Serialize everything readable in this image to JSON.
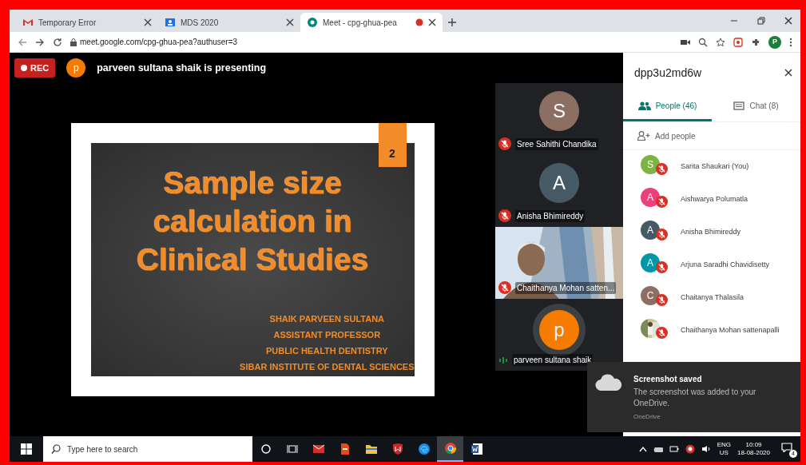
{
  "browser": {
    "tabs": [
      {
        "label": "Temporary Error",
        "selected": false,
        "recording": false
      },
      {
        "label": "MDS 2020",
        "selected": false,
        "recording": false
      },
      {
        "label": "Meet - cpg-ghua-pea",
        "selected": true,
        "recording": true
      }
    ],
    "address": "meet.google.com/cpg-ghua-pea?authuser=3",
    "profile_initial": "P"
  },
  "meet": {
    "rec_label": "REC",
    "presenter_initial": "p",
    "presenting_text": "parveen sultana shaik is presenting",
    "slide": {
      "number": "2",
      "title": [
        "Sample size",
        "calculation in",
        "Clinical Studies"
      ],
      "author_lines": [
        "SHAIK PARVEEN SULTANA",
        "ASSISTANT PROFESSOR",
        "PUBLIC HEALTH DENTISTRY",
        "SIBAR INSTITUTE OF DENTAL SCIENCES"
      ]
    },
    "tiles": [
      {
        "kind": "avatar",
        "initial": "S",
        "color": "#8d6e63",
        "name": "Sree Sahithi Chandika",
        "muted": true
      },
      {
        "kind": "avatar",
        "initial": "A",
        "color": "#455a64",
        "name": "Anisha Bhimireddy",
        "muted": true
      },
      {
        "kind": "video",
        "name": "Chaithanya Mohan satten...",
        "muted": true
      },
      {
        "kind": "avatar",
        "initial": "p",
        "color": "#f57c00",
        "name": "parveen sultana shaik",
        "muted": false
      }
    ]
  },
  "panel": {
    "title": "dpp3u2md6w",
    "tabs": [
      {
        "label": "People (46)",
        "selected": true
      },
      {
        "label": "Chat (8)",
        "selected": false
      }
    ],
    "add_people": "Add people",
    "people": [
      {
        "kind": "letter",
        "initial": "S",
        "color": "#7cb342",
        "name": "Sarita Shaukari (You)",
        "muted": true
      },
      {
        "kind": "letter",
        "initial": "A",
        "color": "#ec407a",
        "name": "Aishwarya Polumatla",
        "muted": true
      },
      {
        "kind": "letter",
        "initial": "A",
        "color": "#455a64",
        "name": "Anisha Bhimireddy",
        "muted": true
      },
      {
        "kind": "letter",
        "initial": "A",
        "color": "#0097a7",
        "name": "Arjuna Saradhi Chavidisetty",
        "muted": true
      },
      {
        "kind": "letter",
        "initial": "C",
        "color": "#8d6e63",
        "name": "Chaitanya Thalasila",
        "muted": true
      },
      {
        "name": "Chaithanya Mohan sattenapalli",
        "muted": true
      }
    ]
  },
  "toast": {
    "title": "Screenshot saved",
    "body": "The screenshot was added to your OneDrive.",
    "source": "OneDrive"
  },
  "taskbar": {
    "search": {
      "placeholder": "Type here to search"
    },
    "apps": [
      {
        "active": false
      },
      {
        "active": false
      },
      {
        "active": false
      },
      {
        "active": false
      },
      {
        "active": false
      },
      {
        "active": true
      },
      {
        "active": false
      }
    ],
    "language": "ENG",
    "region": "US",
    "time": "10:09",
    "date": "18-08-2020",
    "notifications": "4"
  }
}
